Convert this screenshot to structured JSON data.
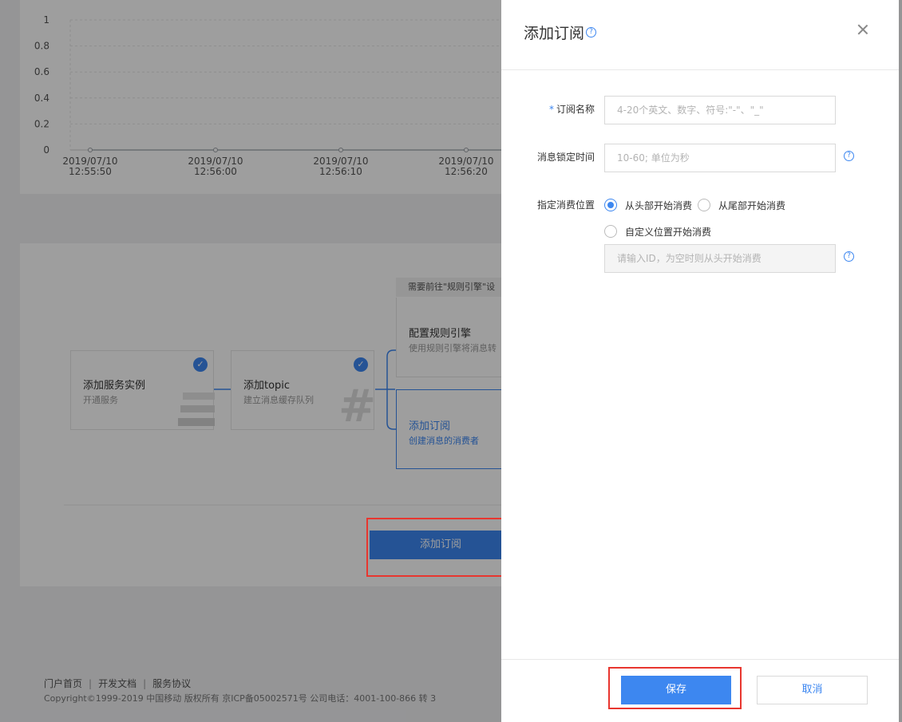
{
  "chart_data": {
    "type": "line",
    "title": "",
    "xlabel": "",
    "ylabel": "",
    "ylim": [
      0,
      1
    ],
    "y_ticks": [
      "1",
      "0.8",
      "0.6",
      "0.4",
      "0.2",
      "0"
    ],
    "x": [
      [
        "2019/07/10",
        "12:55:50"
      ],
      [
        "2019/07/10",
        "12:56:00"
      ],
      [
        "2019/07/10",
        "12:56:10"
      ],
      [
        "2019/07/10",
        "12:56:20"
      ]
    ],
    "series": [
      {
        "values": [
          0,
          0,
          0,
          0,
          0
        ]
      }
    ],
    "line_color": "#9aa0a6",
    "grid": true
  },
  "flow": {
    "steps": [
      {
        "title": "添加服务实例",
        "desc": "开通服务",
        "done": true,
        "icon": "stack-icon"
      },
      {
        "title": "添加topic",
        "desc": "建立消息缓存队列",
        "done": true,
        "icon": "hash-icon"
      },
      {
        "title": "配置规则引擎",
        "desc": "使用规则引擎将消息转",
        "done": false
      },
      {
        "title": "添加订阅",
        "desc": "创建消息的消费者",
        "done": false,
        "active": true
      }
    ],
    "note": "需要前往\"规则引擎\"设",
    "action_label": "添加订阅",
    "hash_glyph": "#"
  },
  "footer": {
    "links": [
      "门户首页",
      "开发文档",
      "服务协议"
    ],
    "separator": "|",
    "copyright": "Copyright©1999-2019 中国移动 版权所有 京ICP备05002571号 公司电话：4001-100-866 转 3"
  },
  "drawer": {
    "title": "添加订阅",
    "help_glyph": "?",
    "form": {
      "name_label": "订阅名称",
      "required_mark": "*",
      "name_placeholder": "4-20个英文、数字、符号:\"-\"、\"_\"",
      "lock_label": "消息锁定时间",
      "lock_placeholder": "10-60; 单位为秒",
      "position_label": "指定消费位置",
      "options": [
        "从头部开始消费",
        "从尾部开始消费",
        "自定义位置开始消费"
      ],
      "selected_option": 0,
      "id_placeholder": "请输入ID，为空时则从头开始消费"
    },
    "save_label": "保存",
    "cancel_label": "取消"
  },
  "colors": {
    "primary": "#3d87f0",
    "highlight_box": "#e8362f"
  }
}
